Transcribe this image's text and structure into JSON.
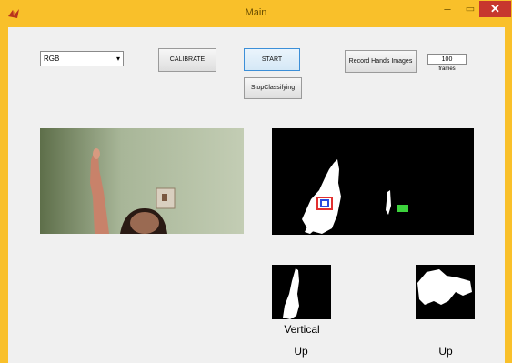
{
  "window": {
    "title": "Main",
    "minimize_glyph": "–",
    "maximize_glyph": "▭",
    "close_glyph": "✕",
    "app_icon": "matlab-icon"
  },
  "controls": {
    "color_mode": {
      "selected": "RGB"
    },
    "calibrate_label": "CALIBRATE",
    "start_label": "START",
    "stop_label": "StopClassifying",
    "record_label": "Record Hands Images",
    "frames_value": "100",
    "frames_label": "frames"
  },
  "results": {
    "orientation_label": "Vertical",
    "direction_left": "Up",
    "direction_right": "Up"
  },
  "colors": {
    "title_bar": "#f9c02a",
    "close_button": "#c7372e",
    "start_border": "#3c8fd8"
  }
}
